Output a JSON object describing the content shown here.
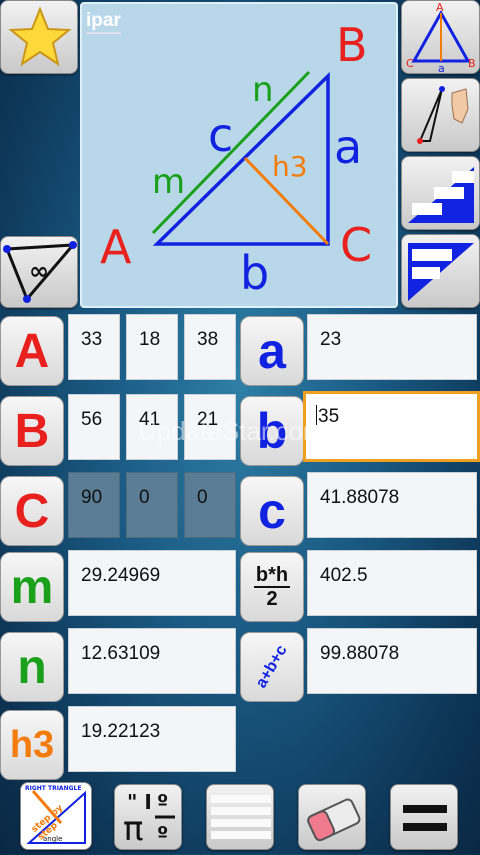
{
  "header": {
    "ipar_label": "ipar"
  },
  "diagram": {
    "vertex_a": "A",
    "vertex_b": "B",
    "vertex_c": "C",
    "side_a": "a",
    "side_b": "b",
    "side_c": "c",
    "seg_m": "m",
    "seg_n": "n",
    "height": "h3"
  },
  "angles": {
    "A": {
      "label": "A",
      "deg": "33",
      "min": "18",
      "sec": "38"
    },
    "B": {
      "label": "B",
      "deg": "56",
      "min": "41",
      "sec": "21"
    },
    "C": {
      "label": "C",
      "deg": "90",
      "min": "0",
      "sec": "0"
    }
  },
  "sides": {
    "a": {
      "label": "a",
      "value": "23"
    },
    "b": {
      "label": "b",
      "value": "35"
    },
    "c": {
      "label": "c",
      "value": "41.88078"
    }
  },
  "segments": {
    "m": {
      "label": "m",
      "value": "29.24969"
    },
    "n": {
      "label": "n",
      "value": "12.63109"
    },
    "h3": {
      "label": "h3",
      "value": "19.22123"
    }
  },
  "area": {
    "label_top": "b*h",
    "label_bottom": "2",
    "value": "402.5"
  },
  "perimeter": {
    "label": "a+b+c",
    "value": "99.88078"
  },
  "toolbar": {
    "help_text_top": "RIGHT TRIANGLE",
    "help_text_mid": "step by step",
    "help_text_bot": "angle",
    "constants_label": "π"
  },
  "watermark": "UpdateStar.com",
  "side_buttons": {
    "infinity": "∞"
  },
  "colors": {
    "red": "#e8211f",
    "blue": "#1122e0",
    "green": "#1aa01a",
    "orange": "#f47c0c"
  }
}
